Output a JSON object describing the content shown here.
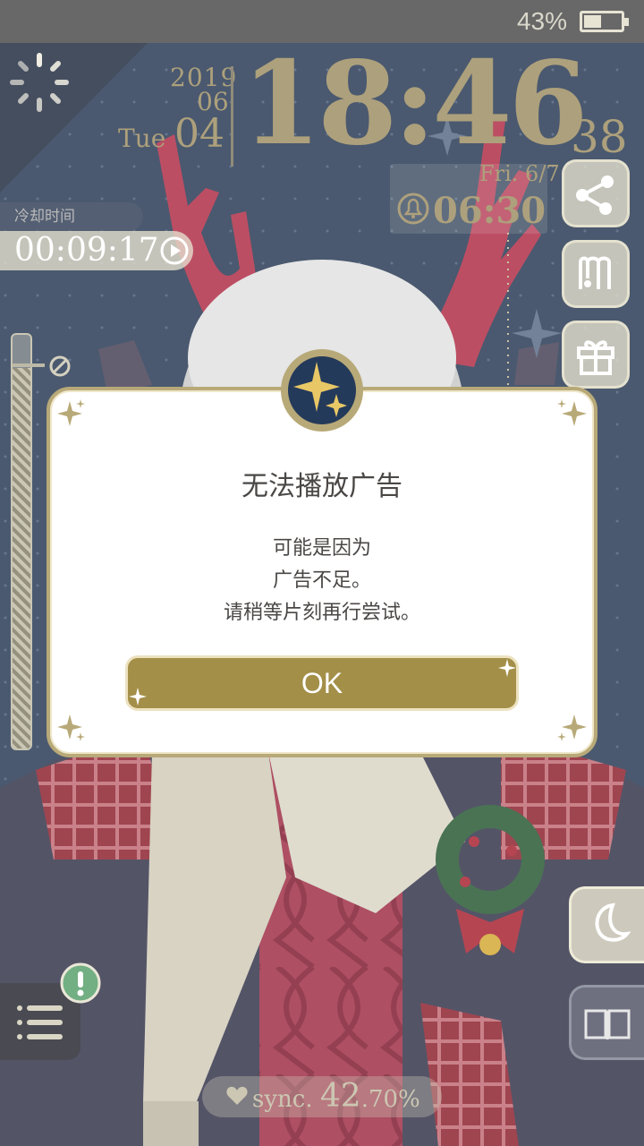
{
  "status_bar": {
    "battery_percent_label": "43%",
    "battery_level": 0.43
  },
  "clock": {
    "year": "2019",
    "month": "06",
    "weekday": "Tue",
    "day": "04",
    "time": "18:46",
    "seconds": "38"
  },
  "alarm": {
    "day": "Fri. 6/7",
    "time": "06:30",
    "icon": "alarm-bell-icon"
  },
  "cooldown": {
    "label": "冷却时间",
    "time": "00:09:17",
    "icon": "play-icon"
  },
  "right_buttons": [
    {
      "name": "share-button",
      "icon": "share-icon"
    },
    {
      "name": "wardrobe-button",
      "icon": "hanger-icon"
    },
    {
      "name": "gift-button",
      "icon": "gift-icon"
    }
  ],
  "slider": {
    "level": 0.92,
    "icon": "no-entry-icon"
  },
  "dialog": {
    "title": "无法播放广告",
    "message_lines": [
      "可能是因为",
      "广告不足。",
      "请稍等片刻再行尝试。"
    ],
    "ok_label": "OK",
    "badge_icon": "star-badge-icon"
  },
  "bottom": {
    "sync_label": "sync.",
    "sync_int": "42",
    "sync_frac": ".70%",
    "menu_icon": "list-icon",
    "alert_icon": "exclamation-icon",
    "moon_icon": "moon-icon",
    "book_icon": "book-icon"
  },
  "colors": {
    "gold": "#a48f49",
    "dialog_border": "#b8a978",
    "background": "#3f4f66"
  }
}
